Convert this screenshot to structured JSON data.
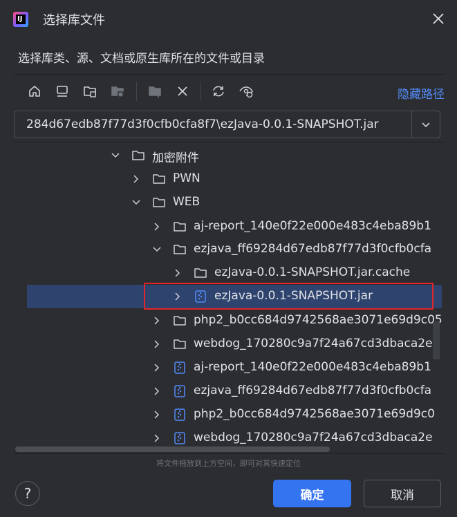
{
  "dialog": {
    "title": "选择库文件",
    "subtitle": "选择库类、源、文档或原生库所在的文件或目录"
  },
  "toolbar": {
    "hide_path_label": "隐藏路径",
    "icons": [
      "home-icon",
      "desktop-icon",
      "project-folder-icon",
      "module-folder-icon",
      "new-folder-icon",
      "delete-icon",
      "refresh-icon",
      "show-hidden-icon"
    ]
  },
  "path": {
    "value": "284d67edb87f77d3f0cfb0cfa8f7\\ezJava-0.0.1-SNAPSHOT.jar"
  },
  "tree": {
    "rows": [
      {
        "label": "加密附件",
        "type": "folder",
        "expanded": true
      },
      {
        "label": "PWN",
        "type": "folder",
        "expanded": false
      },
      {
        "label": "WEB",
        "type": "folder",
        "expanded": true
      },
      {
        "label": "aj-report_140e0f22e000e483c4eba89b1",
        "type": "folder",
        "expanded": false
      },
      {
        "label": "ezjava_ff69284d67edb87f77d3f0cfb0cfa",
        "type": "folder",
        "expanded": true
      },
      {
        "label": "ezJava-0.0.1-SNAPSHOT.jar.cache",
        "type": "folder",
        "expanded": false
      },
      {
        "label": "ezJava-0.0.1-SNAPSHOT.jar",
        "type": "archive",
        "expanded": false,
        "selected": true
      },
      {
        "label": "php2_b0cc684d9742568ae3071e69d9c05",
        "type": "folder",
        "expanded": false
      },
      {
        "label": "webdog_170280c9a7f24a67cd3dbaca2e",
        "type": "folder",
        "expanded": false
      },
      {
        "label": "aj-report_140e0f22e000e483c4eba89b1",
        "type": "archive",
        "expanded": false
      },
      {
        "label": "ezjava_ff69284d67edb87f77d3f0cfb0cfa",
        "type": "archive",
        "expanded": false
      },
      {
        "label": "php2_b0cc684d9742568ae3071e69d9c0",
        "type": "archive",
        "expanded": false
      },
      {
        "label": "webdog_170280c9a7f24a67cd3dbaca2e",
        "type": "archive",
        "expanded": false
      }
    ]
  },
  "hint": "将文件拖放到上方空间，即可对其快速定位",
  "buttons": {
    "help": "?",
    "ok": "确定",
    "cancel": "取消"
  },
  "colors": {
    "accent": "#3574f0",
    "link": "#548af7",
    "selection": "#2e436e",
    "highlight": "#e3242b"
  }
}
